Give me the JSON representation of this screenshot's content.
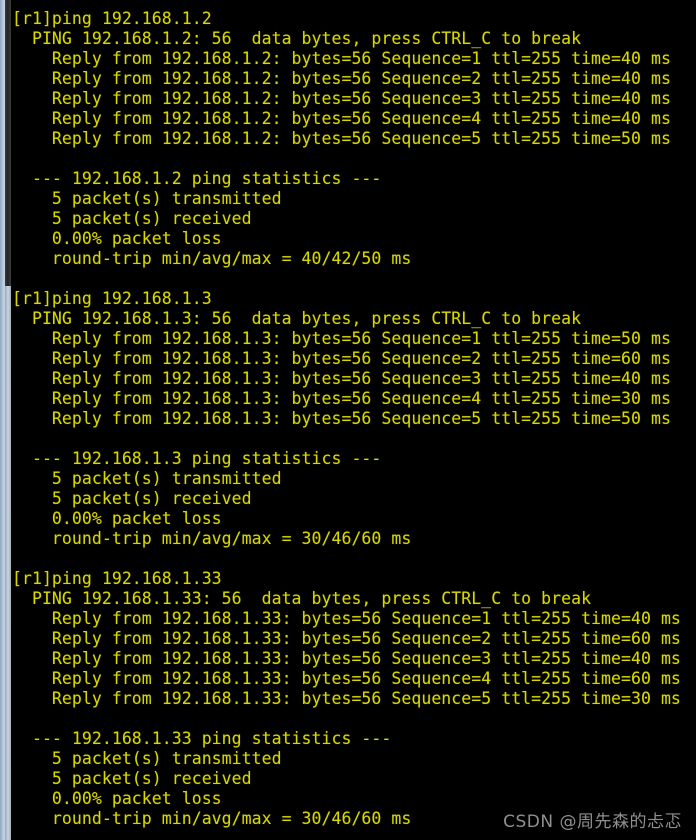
{
  "terminal": {
    "background_color": "#000000",
    "text_color": "#d8d800",
    "lines": [
      "[r1]ping 192.168.1.2",
      "  PING 192.168.1.2: 56  data bytes, press CTRL_C to break",
      "    Reply from 192.168.1.2: bytes=56 Sequence=1 ttl=255 time=40 ms",
      "    Reply from 192.168.1.2: bytes=56 Sequence=2 ttl=255 time=40 ms",
      "    Reply from 192.168.1.2: bytes=56 Sequence=3 ttl=255 time=40 ms",
      "    Reply from 192.168.1.2: bytes=56 Sequence=4 ttl=255 time=40 ms",
      "    Reply from 192.168.1.2: bytes=56 Sequence=5 ttl=255 time=50 ms",
      "",
      "  --- 192.168.1.2 ping statistics ---",
      "    5 packet(s) transmitted",
      "    5 packet(s) received",
      "    0.00% packet loss",
      "    round-trip min/avg/max = 40/42/50 ms",
      "",
      "[r1]ping 192.168.1.3",
      "  PING 192.168.1.3: 56  data bytes, press CTRL_C to break",
      "    Reply from 192.168.1.3: bytes=56 Sequence=1 ttl=255 time=50 ms",
      "    Reply from 192.168.1.3: bytes=56 Sequence=2 ttl=255 time=60 ms",
      "    Reply from 192.168.1.3: bytes=56 Sequence=3 ttl=255 time=40 ms",
      "    Reply from 192.168.1.3: bytes=56 Sequence=4 ttl=255 time=30 ms",
      "    Reply from 192.168.1.3: bytes=56 Sequence=5 ttl=255 time=50 ms",
      "",
      "  --- 192.168.1.3 ping statistics ---",
      "    5 packet(s) transmitted",
      "    5 packet(s) received",
      "    0.00% packet loss",
      "    round-trip min/avg/max = 30/46/60 ms",
      "",
      "[r1]ping 192.168.1.33",
      "  PING 192.168.1.33: 56  data bytes, press CTRL_C to break",
      "    Reply from 192.168.1.33: bytes=56 Sequence=1 ttl=255 time=40 ms",
      "    Reply from 192.168.1.33: bytes=56 Sequence=2 ttl=255 time=60 ms",
      "    Reply from 192.168.1.33: bytes=56 Sequence=3 ttl=255 time=40 ms",
      "    Reply from 192.168.1.33: bytes=56 Sequence=4 ttl=255 time=60 ms",
      "    Reply from 192.168.1.33: bytes=56 Sequence=5 ttl=255 time=30 ms",
      "",
      "  --- 192.168.1.33 ping statistics ---",
      "    5 packet(s) transmitted",
      "    5 packet(s) received",
      "    0.00% packet loss",
      "    round-trip min/avg/max = 30/46/60 ms"
    ]
  },
  "scrollbar": {
    "track_color": "#b6c7dc",
    "thumb_color": "#2b2b2b"
  },
  "watermark": {
    "text": "CSDN @周先森的忐忑",
    "color": "#9c9c9c"
  }
}
